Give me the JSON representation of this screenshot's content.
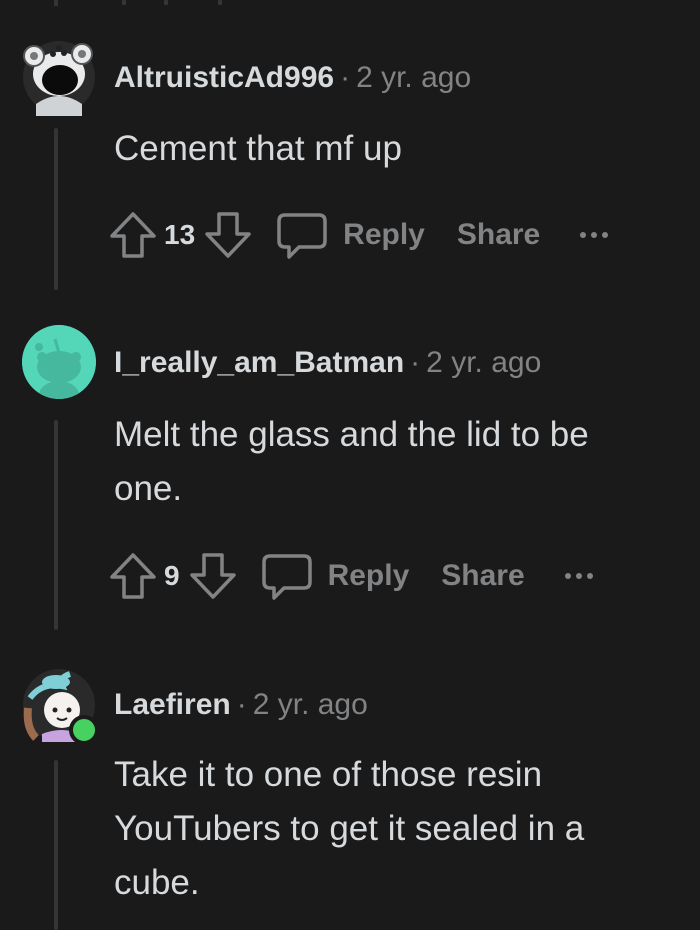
{
  "comments": [
    {
      "username": "AltruisticAd996",
      "age": "2 yr. ago",
      "body": "Cement that mf up",
      "score": "13",
      "reply_label": "Reply",
      "share_label": "Share",
      "avatar": "koala-snoo-avatar-icon"
    },
    {
      "username": "I_really_am_Batman",
      "age": "2 yr. ago",
      "body": "Melt the glass and the lid to be one.",
      "score": "9",
      "reply_label": "Reply",
      "share_label": "Share",
      "avatar": "default-snoo-avatar-icon"
    },
    {
      "username": "Laefiren",
      "age": "2 yr. ago",
      "body": "Take it to one of those resin YouTubers to get it sealed in a cube.",
      "avatar": "character-avatar-icon"
    }
  ],
  "separator": "·",
  "colors": {
    "background": "#1a1a1b",
    "text": "#d7dadc",
    "muted": "#818384",
    "thread_line": "#343536",
    "avatar_teal": "#54d6b8",
    "online": "#46d160"
  }
}
